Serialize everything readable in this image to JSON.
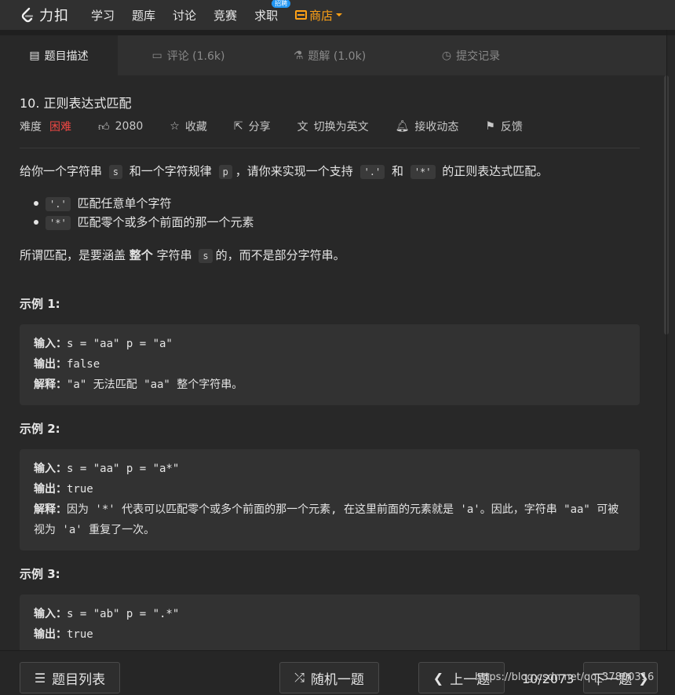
{
  "nav": {
    "logo_text": "力扣",
    "items": [
      "学习",
      "题库",
      "讨论",
      "竞赛",
      "求职"
    ],
    "jobs_badge": "招聘",
    "store": "商店"
  },
  "tabs": [
    {
      "label": "题目描述",
      "icon": "description-icon"
    },
    {
      "label": "评论 (1.6k)",
      "icon": "comment-icon"
    },
    {
      "label": "题解 (1.0k)",
      "icon": "flask-icon"
    },
    {
      "label": "提交记录",
      "icon": "clock-icon"
    }
  ],
  "problem": {
    "title": "10. 正则表达式匹配",
    "difficulty_label": "难度",
    "difficulty": "困难",
    "likes": "2080",
    "favorite": "收藏",
    "share": "分享",
    "switch_lang": "切换为英文",
    "subscribe": "接收动态",
    "feedback": "反馈"
  },
  "description": {
    "p1_a": "给你一个字符串 ",
    "p1_s": "s",
    "p1_b": " 和一个字符规律 ",
    "p1_p": "p",
    "p1_c": "，请你来实现一个支持 ",
    "p1_dot": "'.'",
    "p1_d": " 和 ",
    "p1_star": "'*'",
    "p1_e": " 的正则表达式匹配。",
    "b1_code": "'.'",
    "b1_text": " 匹配任意单个字符",
    "b2_code": "'*'",
    "b2_text": " 匹配零个或多个前面的那一个元素",
    "p2_a": "所谓匹配，是要涵盖 ",
    "p2_bold": "整个",
    "p2_b": " 字符串 ",
    "p2_s": "s",
    "p2_c": "的，而不是部分字符串。"
  },
  "examples": [
    {
      "title": "示例 1:",
      "input_key": "输入：",
      "input": "s = \"aa\" p = \"a\"",
      "output_key": "输出：",
      "output": "false",
      "explain_key": "解释：",
      "explain": "\"a\" 无法匹配 \"aa\" 整个字符串。"
    },
    {
      "title": "示例 2:",
      "input_key": "输入：",
      "input": "s = \"aa\" p = \"a*\"",
      "output_key": "输出：",
      "output": "true",
      "explain_key": "解释：",
      "explain": "因为 '*' 代表可以匹配零个或多个前面的那一个元素, 在这里前面的元素就是 'a'。因此，字符串 \"aa\" 可被视为 'a' 重复了一次。"
    },
    {
      "title": "示例 3:",
      "input_key": "输入：",
      "input": "s = \"ab\" p = \".*\"",
      "output_key": "输出：",
      "output": "true"
    }
  ],
  "bottom": {
    "list": "题目列表",
    "random": "随机一题",
    "prev": "上一题",
    "pager": "10/2073",
    "next": "下一题"
  },
  "watermark": "https://blog.csdn.net/qq_37800316",
  "colors": {
    "accent": "#ffa116",
    "hard": "#ef4743",
    "badge": "#2196f3"
  }
}
